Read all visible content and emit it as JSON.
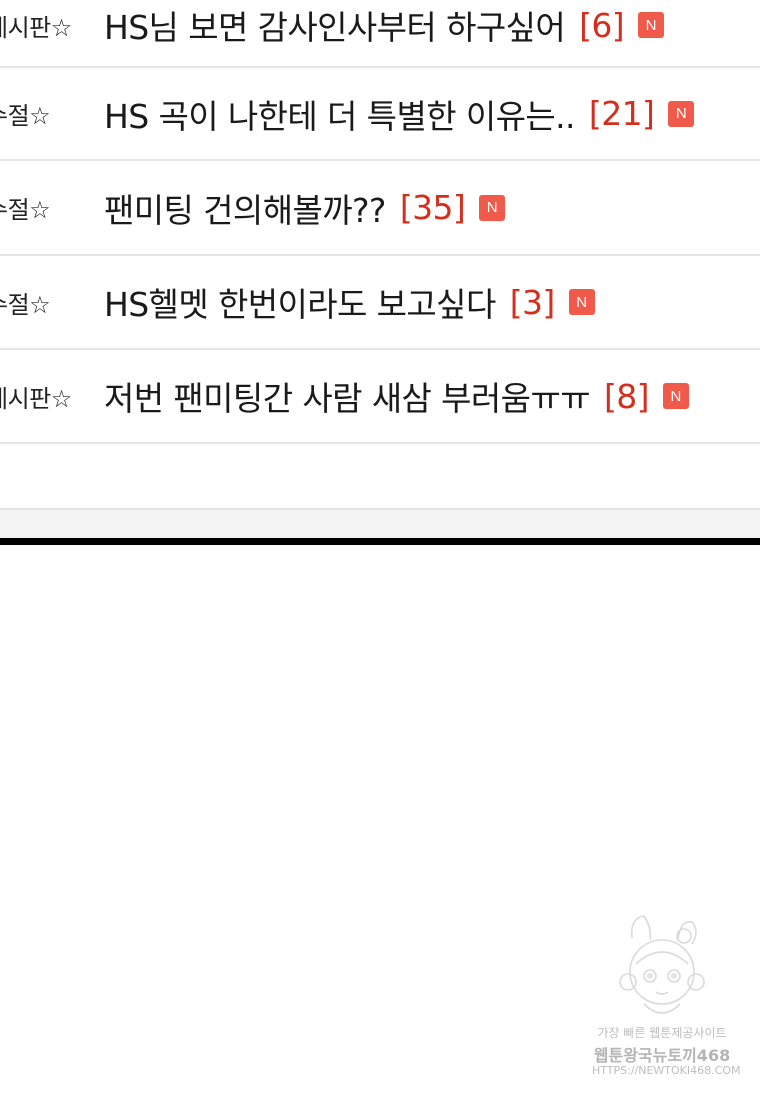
{
  "posts": [
    {
      "category": "게시판☆",
      "title": "HS님 보면 감사인사부터 하구싶어",
      "comments": "[6]",
      "badge": "N"
    },
    {
      "category": "수절☆",
      "title": "HS 곡이 나한테 더 특별한 이유는..",
      "comments": "[21]",
      "badge": "N"
    },
    {
      "category": "수절☆",
      "title": "팬미팅 건의해볼까??",
      "comments": "[35]",
      "badge": "N"
    },
    {
      "category": "수절☆",
      "title": "HS헬멧 한번이라도 보고싶다",
      "comments": "[3]",
      "badge": "N"
    },
    {
      "category": "게시판☆",
      "title": "저번 팬미팅간 사람 새삼 부러움ㅠㅠ",
      "comments": "[8]",
      "badge": "N"
    }
  ],
  "watermark": {
    "line1": "가장 빠른 웹툰제공사이트",
    "line2": "웹툰왕국뉴토끼468",
    "line3": "HTTPS://NEWTOKI468.COM"
  },
  "colors": {
    "comment_count": "#d32f1e",
    "new_badge": "#f05a4b",
    "divider": "#000000"
  }
}
